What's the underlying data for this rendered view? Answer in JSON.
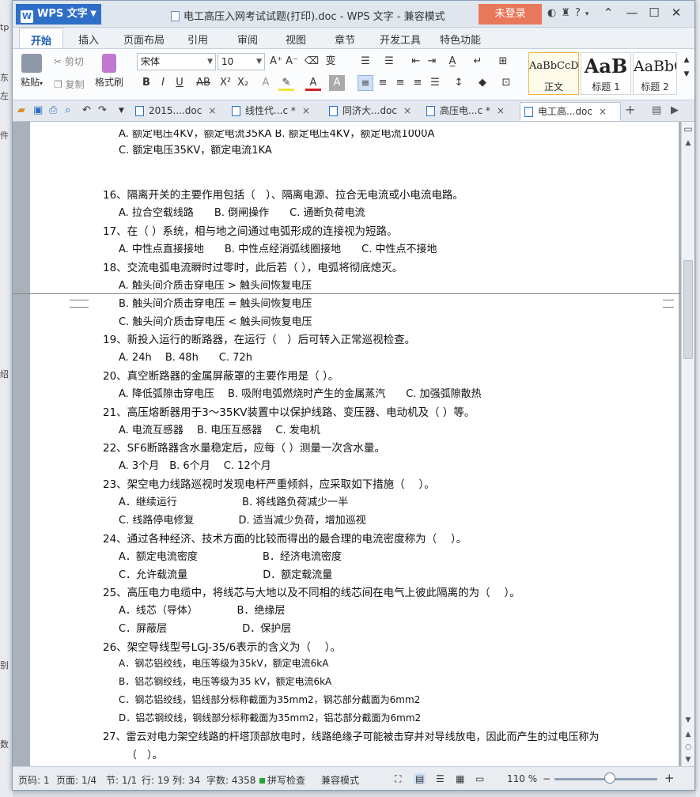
{
  "window": {
    "app_menu": "WPS 文字",
    "title": "电工高压入网考试试题(打印).doc - WPS 文字 - 兼容模式",
    "login": "未登录"
  },
  "menu": [
    "开始",
    "插入",
    "页面布局",
    "引用",
    "审阅",
    "视图",
    "章节",
    "开发工具",
    "特色功能"
  ],
  "ribbon": {
    "paste": "粘贴",
    "cut": "剪切",
    "copy": "复制",
    "format_painter": "格式刷",
    "font": "宋体",
    "size": "10",
    "styles": [
      {
        "preview": "AaBbCcD",
        "label": "正文"
      },
      {
        "preview": "AaB",
        "label": "标题 1"
      },
      {
        "preview": "AaBbC",
        "label": "标题 2"
      }
    ]
  },
  "tabs": [
    "2015....doc",
    "线性代...c *",
    "同济大...doc",
    "高压电...c *",
    "电工高...doc"
  ],
  "document": {
    "prev_page_lines": [
      "A. 额定电压4KV，额定电流35KA     B. 额定电压4KV，额定电流1000A",
      "C. 额定电压35KV，额定电流1KA"
    ],
    "items": [
      {
        "q": "16、隔离开关的主要作用包括（　）、隔离电源、拉合无电流或小电流电路。",
        "opts": [
          "A. 拉合空载线路　　B. 倒闸操作　　C. 通断负荷电流"
        ]
      },
      {
        "q": "17、在（ ）系统，相与地之间通过电弧形成的连接视为短路。",
        "opts": [
          "A. 中性点直接接地　　B. 中性点经消弧线圈接地　　C. 中性点不接地"
        ]
      },
      {
        "q": "18、交流电弧电流瞬时过零时，此后若（ ），电弧将彻底熄灭。",
        "opts": [
          "A. 触头间介质击穿电压 > 触头间恢复电压",
          "B. 触头间介质击穿电压 = 触头间恢复电压",
          "C. 触头间介质击穿电压 < 触头间恢复电压"
        ]
      },
      {
        "q": "19、新投入运行的断路器，在运行（　）后可转入正常巡视检查。",
        "opts": [
          "A. 24h　 B. 48h　　C. 72h"
        ]
      },
      {
        "q": "20、真空断路器的金属屏蔽罩的主要作用是（ ）。",
        "opts": [
          "A. 降低弧隙击穿电压　 B. 吸附电弧燃烧时产生的金属蒸汽　　C. 加强弧隙散热"
        ]
      },
      {
        "q": "21、高压熔断器用于3～35KV装置中以保护线路、变压器、电动机及（ ）等。",
        "opts": [
          "A. 电流互感器　 B. 电压互感器　 C. 发电机"
        ]
      },
      {
        "q": "22、SF6断路器含水量稳定后，应每（ ）测量一次含水量。",
        "opts": [
          "A. 3个月　B. 6个月　 C. 12个月"
        ]
      },
      {
        "q": "23、架空电力线路巡视时发现电杆严重倾斜，应采取如下措施（　 ）。",
        "opts": [
          "A．继续运行　　　　　　 B. 将线路负荷减少一半",
          "C. 线路停电修复　　　　 D. 适当减少负荷，增加巡视"
        ]
      },
      {
        "q": "24、通过各种经济、技术方面的比较而得出的最合理的电流密度称为（　 ）。",
        "opts": [
          "A．额定电流密度　　　　　　 B．经济电流密度",
          "C．允许载流量　　　　　　　 D．额定载流量"
        ]
      },
      {
        "q": "25、高压电力电缆中，将线芯与大地以及不同相的线芯间在电气上彼此隔离的为（　 ）。",
        "opts": [
          "A．线芯（导体）　　　　 B．绝缘层",
          "C．屏蔽层　　　　　　　 D．保护层"
        ]
      },
      {
        "q": "26、架空导线型号LGJ-35/6表示的含义为（　 ）。",
        "opts": [
          "A．钢芯铝绞线，电压等级为35kV，额定电流6kA",
          "B．铝芯钢绞线，电压等级为35 kV，额定电流6kA",
          "C．钢芯铝绞线，铝线部分标称截面为35mm2，钢芯部分截面为6mm2",
          "D．铝芯钢绞线，钢线部分标称截面为35mm2，铝芯部分截面为6mm2"
        ]
      },
      {
        "q": "27、雷云对电力架空线路的杆塔顶部放电时，线路绝缘子可能被击穿并对导线放电，因此而产生的过电压称为",
        "opts": [
          "（　）。"
        ]
      }
    ]
  },
  "status": {
    "page": "页码: 1",
    "pages": "页面: 1/4",
    "section": "节: 1/1",
    "row": "行: 19",
    "col": "列: 34",
    "words": "字数: 4358",
    "spell": "拼写检查",
    "mode": "兼容模式",
    "zoom": "110 %"
  },
  "background_window": {
    "left_labels": [
      "tp",
      "东",
      "左",
      "件",
      "绍",
      "别",
      "数"
    ]
  }
}
